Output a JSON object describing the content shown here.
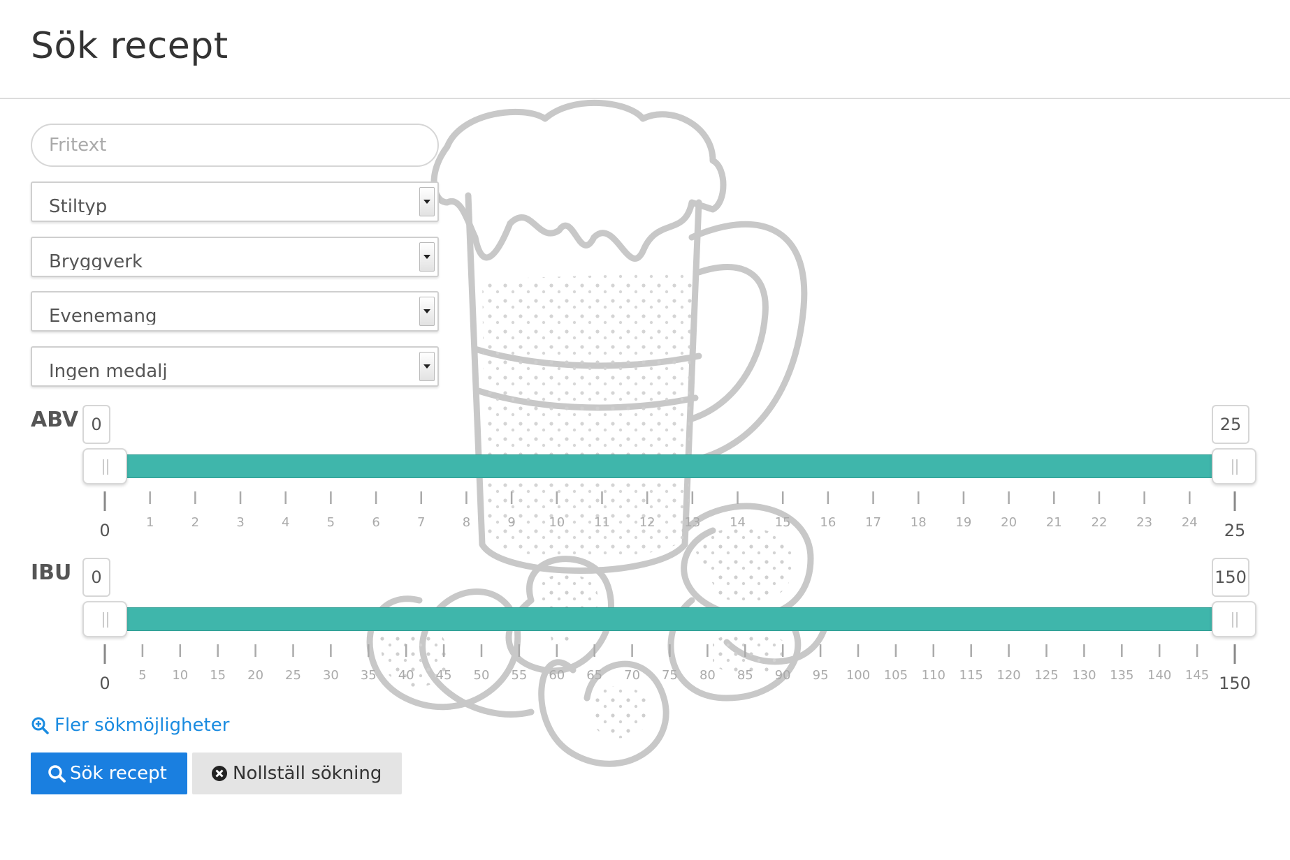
{
  "header": {
    "title": "Sök recept"
  },
  "search": {
    "placeholder": "Fritext",
    "value": ""
  },
  "filters": [
    {
      "label": "Stiltyp"
    },
    {
      "label": "Bryggverk"
    },
    {
      "label": "Evenemang"
    },
    {
      "label": "Ingen medalj"
    }
  ],
  "sliders": {
    "abv": {
      "label": "ABV",
      "min_value": "0",
      "max_value": "25",
      "range_min": 0,
      "range_max": 25,
      "step": 1,
      "end_labels": [
        "0",
        "25"
      ]
    },
    "ibu": {
      "label": "IBU",
      "min_value": "0",
      "max_value": "150",
      "range_min": 0,
      "range_max": 150,
      "step": 5,
      "end_labels": [
        "0",
        "150"
      ]
    }
  },
  "more_options": {
    "label": "Fler sökmöjligheter",
    "icon": "zoom-in-icon"
  },
  "buttons": {
    "search": {
      "label": "Sök recept",
      "icon": "search-icon"
    },
    "reset": {
      "label": "Nollställ sökning",
      "icon": "close-circle-icon"
    }
  },
  "colors": {
    "accent": "#1a7fe0",
    "slider_track": "#3fb6ab",
    "link": "#1a8be0",
    "reset_bg": "#e4e4e4"
  }
}
